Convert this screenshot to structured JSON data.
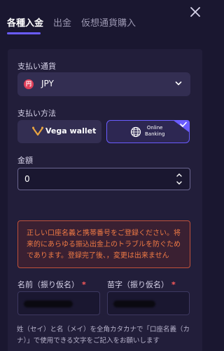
{
  "tabs": [
    {
      "label": "各種入金",
      "active": true
    },
    {
      "label": "出金",
      "active": false
    },
    {
      "label": "仮想通貨購入",
      "active": false
    }
  ],
  "icons": {
    "close": "close-icon",
    "currency": "yen-coin-icon",
    "chevron": "chevron-down-icon",
    "vega": "vega-logo-icon",
    "online": "globe-icon",
    "check": "check-icon",
    "stepper": "number-stepper-icon"
  },
  "currency": {
    "label": "支払い通貨",
    "coin_symbol": "円",
    "value": "JPY"
  },
  "payment_method": {
    "label": "支払い方法",
    "options": [
      {
        "label": "Vega wallet",
        "selected": false
      },
      {
        "label_line1": "Online",
        "label_line2": "Banking",
        "selected": true
      }
    ]
  },
  "amount": {
    "label": "金額",
    "value": "0"
  },
  "warning": {
    "text": "正しい口座名義と携帯番号をご登録ください。将来的にあらゆる振込出金上のトラブルを防ぐためであります。登録完了後、，変更は出来ません"
  },
  "name_fields": {
    "first_label": "名前（振り仮名）",
    "last_label": "苗字（振り仮名）",
    "required_mark": "*"
  },
  "note": {
    "text": "姓（セイ）と名（メイ）を全角カタカナで「口座名義（カナ）」で使用できる文字をご記入をお願いします"
  },
  "colors": {
    "accent": "#6a5cff",
    "background": "#1a1730",
    "panel": "#221e3a",
    "warning": "#f07a45",
    "required": "#ff5b5b"
  }
}
